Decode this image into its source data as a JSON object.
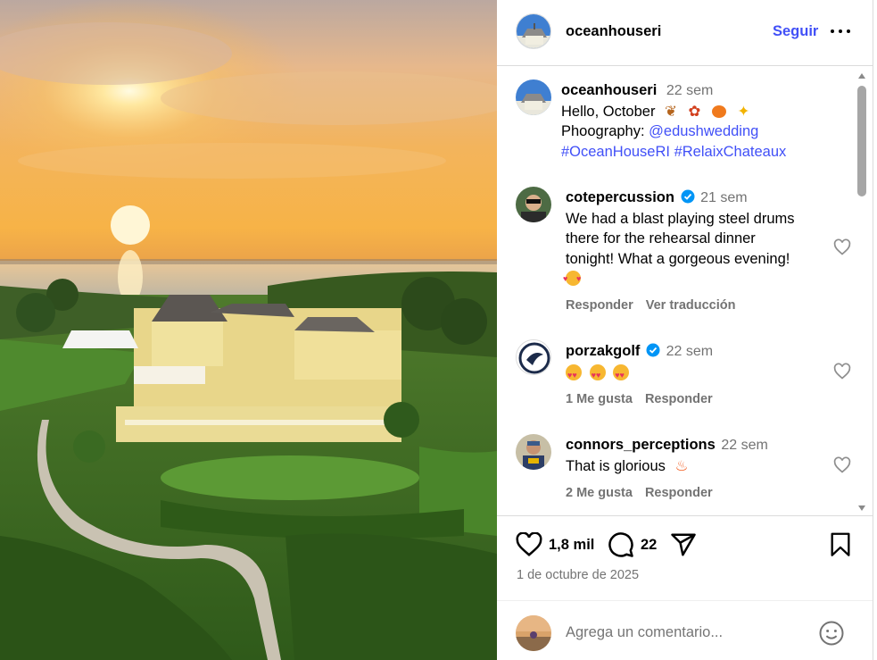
{
  "post": {
    "username": "oceanhouseri",
    "follow_label": "Seguir",
    "caption": {
      "username": "oceanhouseri",
      "time": "22 sem",
      "line1": "Hello, October",
      "line1_emojis": [
        "fallen-leaf",
        "maple-leaf",
        "jack-o-lantern",
        "sparkles"
      ],
      "line2_prefix": "Phoography: ",
      "line2_mention": "@edushwedding",
      "hashtag1": "#OceanHouseRI",
      "hashtag2": "#RelaixChateaux"
    }
  },
  "comments": [
    {
      "username": "cotepercussion",
      "verified": true,
      "time": "21 sem",
      "lines": [
        "We had a blast playing steel drums",
        "there for the rehearsal dinner",
        "tonight! What a gorgeous evening!"
      ],
      "emojis": [
        "smiling-face-with-hearts"
      ],
      "reply_label": "Responder",
      "translate_label": "Ver traducción"
    },
    {
      "username": "porzakgolf",
      "verified": true,
      "time": "22 sem",
      "emojis": [
        "heart-eyes",
        "heart-eyes",
        "heart-eyes"
      ],
      "likes_label": "1 Me gusta",
      "reply_label": "Responder"
    },
    {
      "username": "connors_perceptions",
      "verified": false,
      "time": "22 sem",
      "text": "That is glorious",
      "emojis": [
        "fire"
      ],
      "likes_label": "2 Me gusta",
      "reply_label": "Responder"
    }
  ],
  "footer": {
    "likes": "1,8 mil",
    "comments": "22",
    "date": "1 de octubre de 2025",
    "comment_placeholder": "Agrega un comentario..."
  },
  "icons": [
    "heart-icon",
    "comment-icon",
    "share-icon",
    "bookmark-icon",
    "emoji-icon",
    "more-icon",
    "verified-icon"
  ],
  "colors": {
    "link": "#4150f7",
    "muted": "#737373",
    "verified": "#0095f6",
    "divider": "#dbdbdb"
  }
}
